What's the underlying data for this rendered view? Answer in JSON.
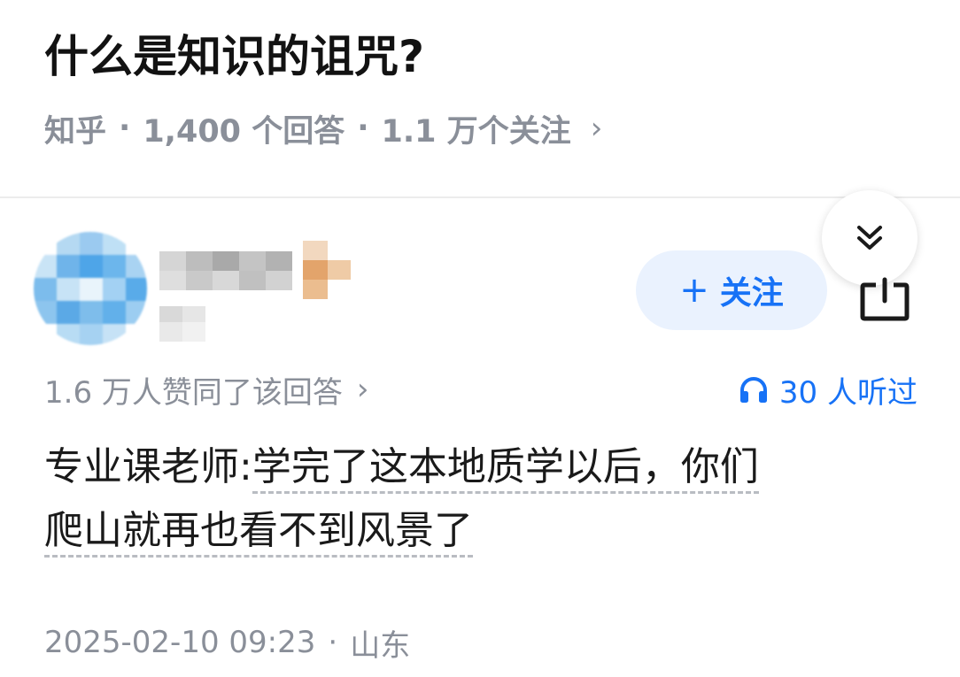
{
  "question": {
    "title": "什么是知识的诅咒?",
    "source": "知乎",
    "answers": "1,400 个回答",
    "followers": "1.1 万个关注",
    "chevron": "›"
  },
  "answer": {
    "author_masked": true,
    "follow_label": "关注",
    "follow_plus": "+",
    "votes_label": "1.6 万人赞同了该回答",
    "votes_chevron": "›",
    "listened_label": "30 人听过",
    "text_line1_prefix": "专业课老师:",
    "text_line1_rest": "学完了这本地质学以后，你们",
    "text_line2": "爬山就再也看不到风景了",
    "date": "2025-02-10 09:23",
    "location": "山东"
  },
  "separator": "·",
  "colors": {
    "accent": "#1772f6",
    "follow_bg": "#eaf2fe",
    "meta_gray": "#8a8f99",
    "title": "#121212"
  },
  "icons": {
    "collapse": "double-chevron-down-icon",
    "share": "share-icon",
    "listen": "headphones-icon"
  }
}
